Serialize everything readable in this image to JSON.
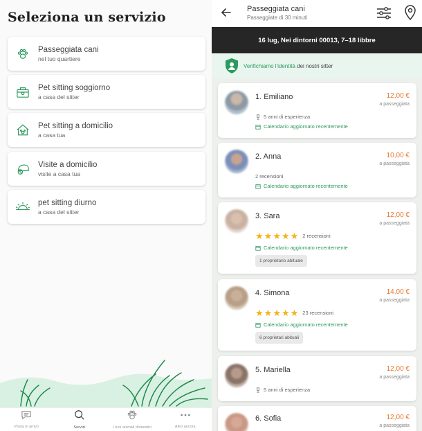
{
  "left": {
    "title": "Seleziona un servizio",
    "services": [
      {
        "title": "Passeggiata cani",
        "subtitle": "nel tuo quartiere",
        "icon": "paw-icon"
      },
      {
        "title": "Pet sitting soggiorno",
        "subtitle": "a casa del sitter",
        "icon": "bag-icon"
      },
      {
        "title": "Pet sitting a domicilio",
        "subtitle": "a casa tua",
        "icon": "house-paw-icon"
      },
      {
        "title": "Visite a domicilio",
        "subtitle": "visite a casa tua",
        "icon": "dog-ball-icon"
      },
      {
        "title": "pet sitting diurno",
        "subtitle": "a casa del sitter",
        "icon": "sun-icon"
      }
    ],
    "tabs": [
      {
        "label": "Posta in arrivo",
        "icon": "chat-icon"
      },
      {
        "label": "Servizi",
        "icon": "search-icon"
      },
      {
        "label": "I tuoi animali domestici",
        "icon": "paw-icon"
      },
      {
        "label": "Altro ancora",
        "icon": "more-icon"
      }
    ]
  },
  "right": {
    "title": "Passeggiata cani",
    "subtitle": "Passeggiate di 30 minuti",
    "search_summary": "16 lug, Nei dintorni 00013, 7–18 libbre",
    "verify_prefix": "Verifichiamo l'identità",
    "verify_suffix": " dei nostri sitter",
    "sitters": [
      {
        "name": "1. Emiliano",
        "price": "12,00 €",
        "per": "a passeggiata",
        "experience": "5 anni di esperienza",
        "calendar": "Calendario aggiornato recentemente"
      },
      {
        "name": "2. Anna",
        "price": "10,00 €",
        "per": "a passeggiata",
        "reviews": "2 recensioni",
        "calendar": "Calendario aggiornato recentemente"
      },
      {
        "name": "3. Sara",
        "price": "12,00 €",
        "per": "a passeggiata",
        "stars": 5,
        "reviews": "2 recensioni",
        "calendar": "Calendario aggiornato recentemente",
        "chip": "1 proprietario abituale"
      },
      {
        "name": "4. Simona",
        "price": "14,00 €",
        "per": "a passeggiata",
        "stars": 5,
        "reviews": "23 recensioni",
        "calendar": "Calendario aggiornato recentemente",
        "chip": "6 proprietari abituali"
      },
      {
        "name": "5. Mariella",
        "price": "12,00 €",
        "per": "a passeggiata",
        "experience": "5 anni di esperienza"
      },
      {
        "name": "6. Sofia",
        "price": "12,00 €",
        "per": "a passeggiata"
      }
    ],
    "colors": {
      "accent_green": "#2e9a5e",
      "price_orange": "#e8772e",
      "dark_bar": "#262626",
      "star": "#f2b316"
    }
  }
}
